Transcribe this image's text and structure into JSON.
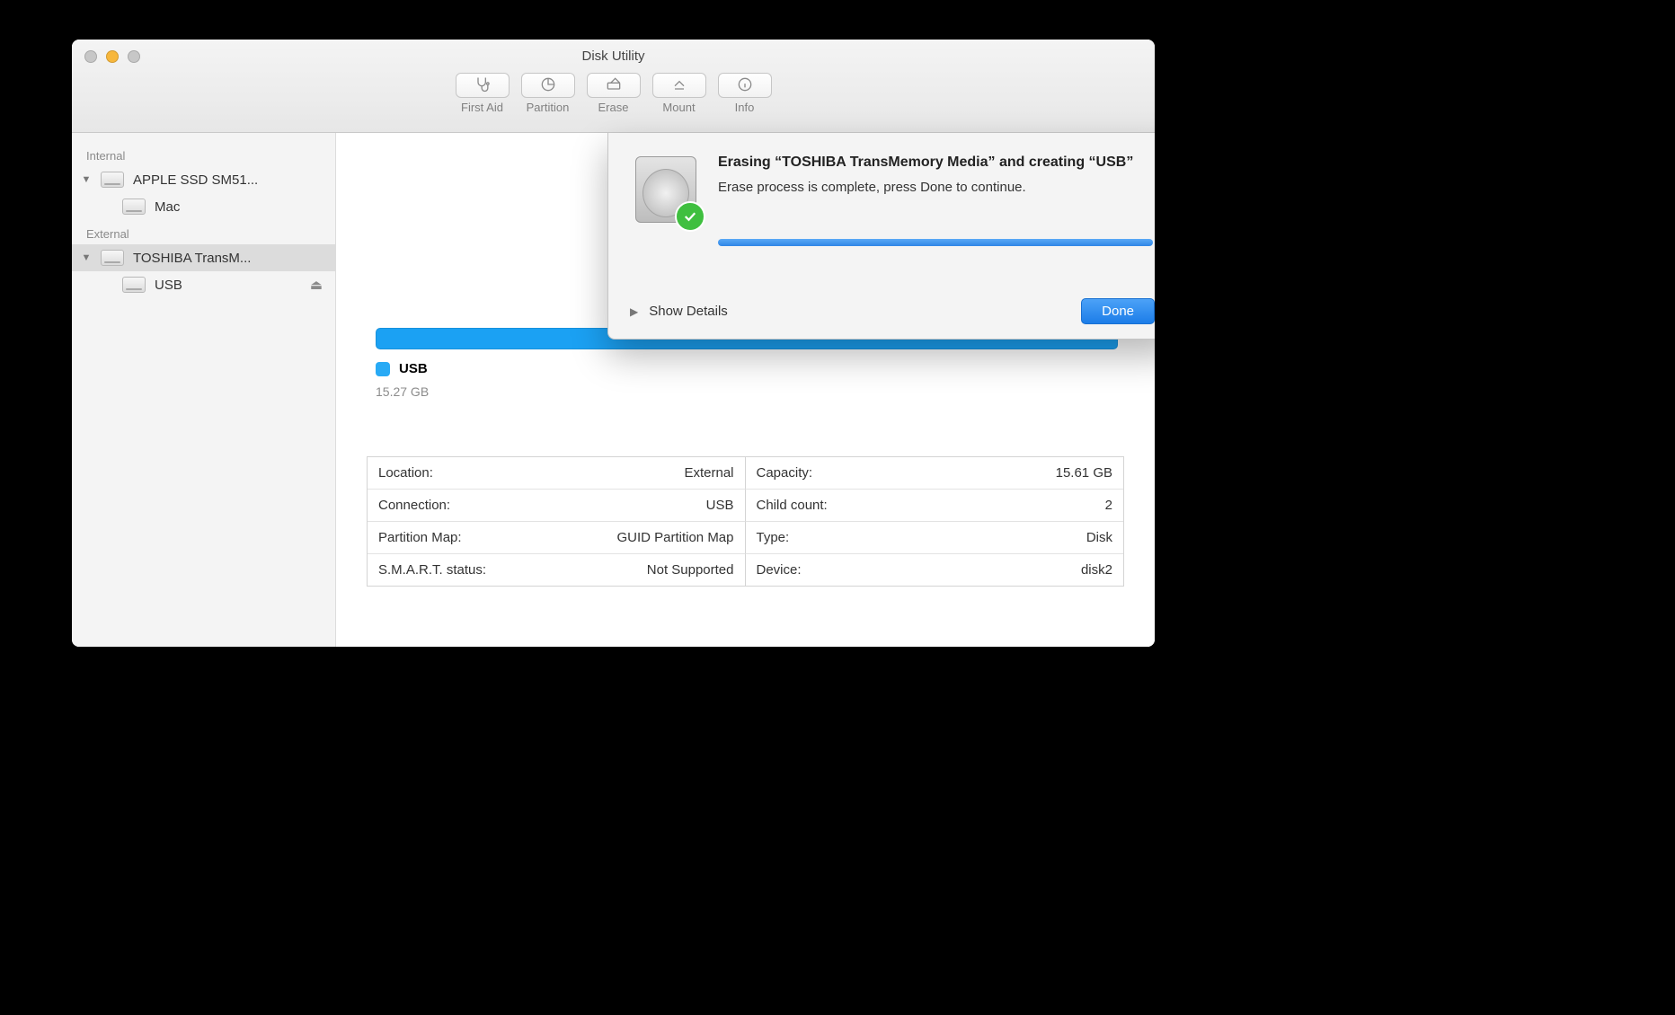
{
  "window": {
    "title": "Disk Utility"
  },
  "toolbar": {
    "first_aid": "First Aid",
    "partition": "Partition",
    "erase": "Erase",
    "mount": "Mount",
    "info": "Info"
  },
  "sidebar": {
    "sections": {
      "internal": "Internal",
      "external": "External"
    },
    "internal_disk": "APPLE SSD SM51...",
    "internal_vol": "Mac",
    "external_disk": "TOSHIBA TransM...",
    "external_vol": "USB"
  },
  "main": {
    "vol_name": "USB",
    "vol_size": "15.27 GB",
    "info": [
      {
        "k": "Location:",
        "v": "External"
      },
      {
        "k": "Connection:",
        "v": "USB"
      },
      {
        "k": "Partition Map:",
        "v": "GUID Partition Map"
      },
      {
        "k": "S.M.A.R.T. status:",
        "v": "Not Supported"
      },
      {
        "k": "Capacity:",
        "v": "15.61 GB"
      },
      {
        "k": "Child count:",
        "v": "2"
      },
      {
        "k": "Type:",
        "v": "Disk"
      },
      {
        "k": "Device:",
        "v": "disk2"
      }
    ]
  },
  "sheet": {
    "title": "Erasing “TOSHIBA TransMemory Media” and creating “USB”",
    "subtitle": "Erase process is complete, press Done to continue.",
    "progress_pct": 100,
    "show_details": "Show Details",
    "done": "Done"
  }
}
